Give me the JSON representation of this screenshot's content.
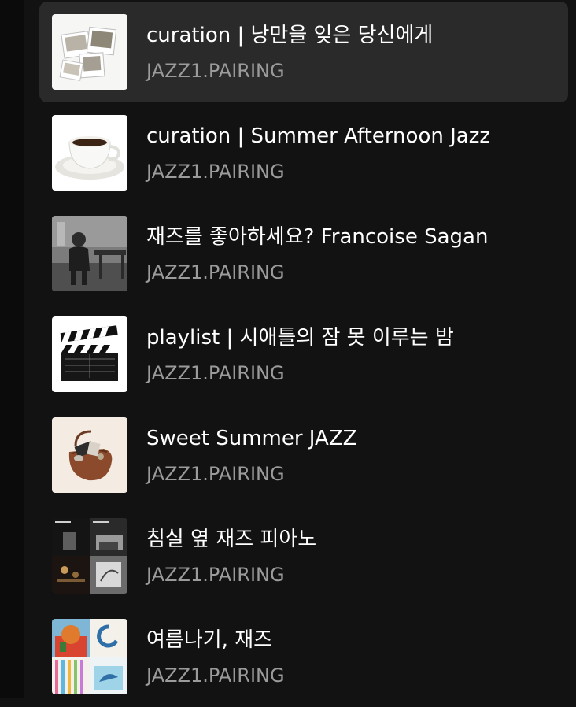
{
  "playlists": [
    {
      "title": "curation | 낭만을 잊은 당신에게",
      "owner": "JAZZ1.PAIRING",
      "art": "photos-collage-icon",
      "active": true
    },
    {
      "title": "curation | Summer Afternoon Jazz",
      "owner": "JAZZ1.PAIRING",
      "art": "coffee-cup-icon",
      "active": false
    },
    {
      "title": "재즈를 좋아하세요? Francoise Sagan",
      "owner": "JAZZ1.PAIRING",
      "art": "vintage-photo-icon",
      "active": false
    },
    {
      "title": "playlist | 시애틀의 잠 못 이루는 밤",
      "owner": "JAZZ1.PAIRING",
      "art": "clapperboard-icon",
      "active": false
    },
    {
      "title": "Sweet Summer JAZZ",
      "owner": "JAZZ1.PAIRING",
      "art": "handbag-icon",
      "active": false
    },
    {
      "title": "침실 옆 재즈 피아노",
      "owner": "JAZZ1.PAIRING",
      "art": "album-grid-icon",
      "active": false
    },
    {
      "title": "여름나기, 재즈",
      "owner": "JAZZ1.PAIRING",
      "art": "colorful-collage-icon",
      "active": false
    }
  ]
}
